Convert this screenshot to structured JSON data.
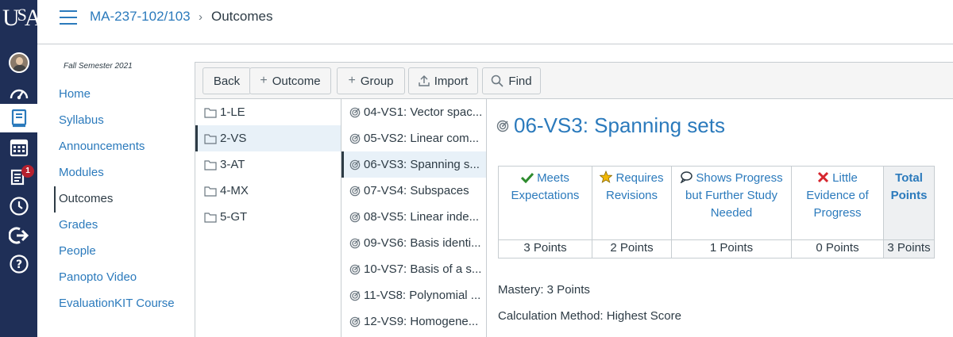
{
  "app": {
    "logo_text": "USA"
  },
  "global_nav": {
    "inbox_badge": "1"
  },
  "header": {
    "course": "MA-237-102/103",
    "separator": "›",
    "current": "Outcomes"
  },
  "course_nav": {
    "term": "Fall Semester 2021",
    "items": [
      "Home",
      "Syllabus",
      "Announcements",
      "Modules",
      "Outcomes",
      "Grades",
      "People",
      "Panopto Video",
      "EvaluationKIT Course"
    ],
    "active": "Outcomes"
  },
  "toolbar": {
    "back": "Back",
    "outcome": "Outcome",
    "group": "Group",
    "import": "Import",
    "find": "Find"
  },
  "groups": [
    "1-LE",
    "2-VS",
    "3-AT",
    "4-MX",
    "5-GT"
  ],
  "selected_group": "2-VS",
  "outcomes": [
    "04-VS1: Vector spac...",
    "05-VS2: Linear com...",
    "06-VS3: Spanning s...",
    "07-VS4: Subspaces",
    "08-VS5: Linear inde...",
    "09-VS6: Basis identi...",
    "10-VS7: Basis of a s...",
    "11-VS8: Polynomial ...",
    "12-VS9: Homogene..."
  ],
  "selected_outcome": "06-VS3: Spanning s...",
  "detail": {
    "title": "06-VS3: Spanning sets",
    "ratings": [
      {
        "label_lines": [
          "Meets",
          "Expectations"
        ],
        "points": "3 Points",
        "icon": "check-icon",
        "color": "#2e8b2e"
      },
      {
        "label_lines": [
          "Requires",
          "Revisions"
        ],
        "points": "2 Points",
        "icon": "star-icon",
        "color": "#f2b705"
      },
      {
        "label_lines": [
          "Shows Progress",
          "but Further Study",
          "Needed"
        ],
        "points": "1 Points",
        "icon": "speech-bubble-icon",
        "color": "#2d3b45"
      },
      {
        "label_lines": [
          "Little",
          "Evidence of",
          "Progress"
        ],
        "points": "0 Points",
        "icon": "x-mark-icon",
        "color": "#d6262e"
      }
    ],
    "total": {
      "label_lines": [
        "Total",
        "Points"
      ],
      "points": "3 Points"
    },
    "mastery": "Mastery: 3 Points",
    "calculation": "Calculation Method: Highest Score"
  }
}
